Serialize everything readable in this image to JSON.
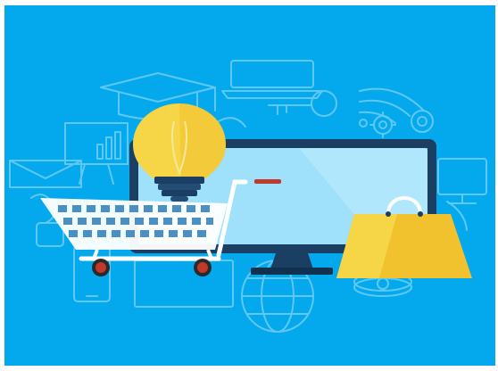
{
  "illustration": {
    "colors": {
      "background": "#03a9ec",
      "outline": "#5fc8f2",
      "monitor_frame": "#1a3f63",
      "monitor_screen": "#9fe0fb",
      "bulb_yellow": "#f6d646",
      "bag_yellow": "#f2c12e",
      "cart_white": "#ffffff",
      "wheel_red": "#c0392b"
    },
    "icons": [
      "monitor-icon",
      "light-bulb-icon",
      "shopping-cart-icon",
      "shopping-bag-icon",
      "graduation-cap-icon",
      "laptop-icon",
      "wifi-icon",
      "magnifier-icon",
      "gear-icon",
      "envelope-icon",
      "chart-icon",
      "globe-icon",
      "smartphone-icon",
      "coin-icon",
      "tablet-icon",
      "presentation-board-icon"
    ]
  }
}
